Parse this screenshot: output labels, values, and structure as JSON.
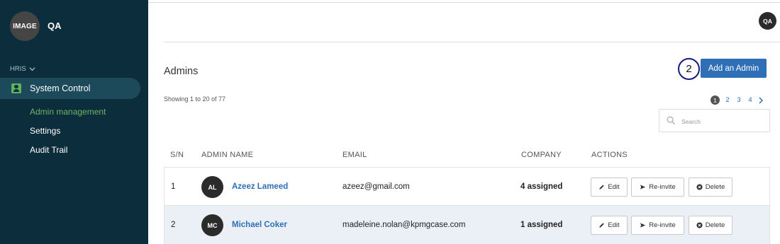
{
  "sidebar": {
    "logo_text": "IMAGE",
    "org_name": "QA",
    "section_label": "HRIS",
    "active_item": "System Control",
    "sub_items": [
      "Admin management",
      "Settings",
      "Audit Trail"
    ]
  },
  "header": {
    "user_initials": "QA"
  },
  "main": {
    "title": "Admins",
    "step_marker": "2",
    "add_button": "Add an Admin",
    "showing_text": "Showing 1 to 20 of 77",
    "pagination": {
      "current": "1",
      "pages": [
        "2",
        "3",
        "4"
      ]
    },
    "search_placeholder": "Search",
    "columns": [
      "S/N",
      "ADMIN NAME",
      "EMAIL",
      "COMPANY",
      "ACTIONS"
    ],
    "rows": [
      {
        "sn": "1",
        "initials": "AL",
        "name": "Azeez Lameed",
        "email": "azeez@gmail.com",
        "company": "4 assigned"
      },
      {
        "sn": "2",
        "initials": "MC",
        "name": "Michael Coker",
        "email": "madeleine.nolan@kpmgcase.com",
        "company": "1 assigned"
      }
    ],
    "actions": {
      "edit": "Edit",
      "reinvite": "Re-invite",
      "delete": "Delete"
    }
  },
  "colors": {
    "sidebar_bg": "#0c2d3b",
    "active_item_bg": "#1c4a5a",
    "accent_green": "#6cb564",
    "primary_blue": "#2f6fb6",
    "row_highlight": "#ebf0f6"
  }
}
